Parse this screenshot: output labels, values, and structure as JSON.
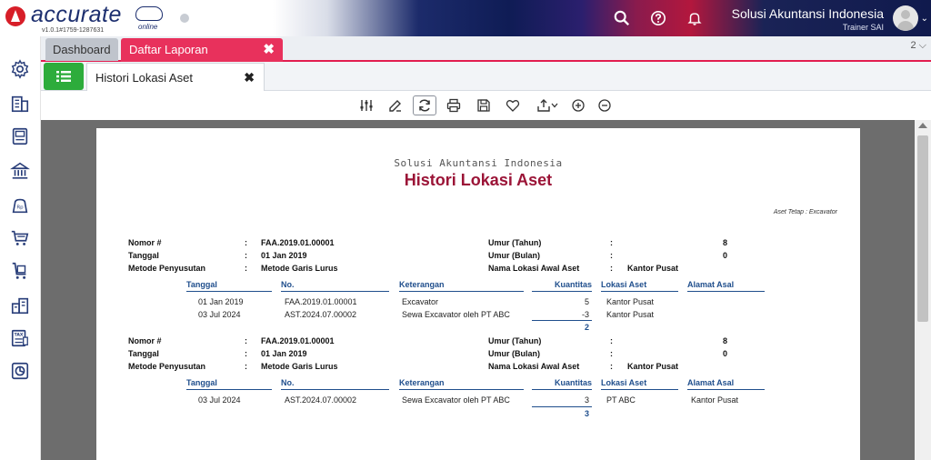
{
  "app": {
    "brand": "accurate",
    "brand_sub": "online",
    "version": "v1.0.1#1759-1287631",
    "company_name": "Solusi Akuntansi Indonesia",
    "user_name": "Trainer SAI"
  },
  "tabs": {
    "dashboard": "Dashboard",
    "daftar_laporan": "Daftar Laporan",
    "close": "✖",
    "count": "2 ⌵",
    "histori": "Histori Lokasi Aset"
  },
  "report": {
    "company": "Solusi Akuntansi Indonesia",
    "title": "Histori Lokasi Aset",
    "filter": "Aset Tetap : Excavator",
    "labels": {
      "nomor": "Nomor #",
      "tanggal": "Tanggal",
      "metode": "Metode Penyusutan",
      "umur_tahun": "Umur (Tahun)",
      "umur_bulan": "Umur (Bulan)",
      "lokasi_awal": "Nama Lokasi Awal Aset",
      "colon": ":"
    },
    "columns": {
      "tanggal": "Tanggal",
      "no": "No.",
      "keterangan": "Keterangan",
      "kuantitas": "Kuantitas",
      "lokasi": "Lokasi Aset",
      "alamat": "Alamat Asal"
    },
    "groups": [
      {
        "nomor": "FAA.2019.01.00001",
        "tanggal": "01 Jan 2019",
        "metode": "Metode Garis Lurus",
        "umur_tahun": "8",
        "umur_bulan": "0",
        "lokasi_awal": "Kantor Pusat",
        "rows": [
          {
            "tanggal": "01 Jan 2019",
            "no": "FAA.2019.01.00001",
            "keterangan": "Excavator",
            "kuantitas": "5",
            "lokasi": "Kantor Pusat",
            "alamat": ""
          },
          {
            "tanggal": "03 Jul 2024",
            "no": "AST.2024.07.00002",
            "keterangan": "Sewa Excavator oleh PT ABC",
            "kuantitas": "-3",
            "lokasi": "Kantor Pusat",
            "alamat": ""
          }
        ],
        "total": "2"
      },
      {
        "nomor": "FAA.2019.01.00001",
        "tanggal": "01 Jan 2019",
        "metode": "Metode Garis Lurus",
        "umur_tahun": "8",
        "umur_bulan": "0",
        "lokasi_awal": "Kantor Pusat",
        "rows": [
          {
            "tanggal": "03 Jul 2024",
            "no": "AST.2024.07.00002",
            "keterangan": "Sewa Excavator oleh PT ABC",
            "kuantitas": "3",
            "lokasi": "PT ABC",
            "alamat": "Kantor Pusat"
          }
        ],
        "total": "3"
      }
    ]
  },
  "icons": {
    "top": [
      "search-icon",
      "help-icon",
      "bell-icon"
    ],
    "sidebar": [
      "settings-icon",
      "company-icon",
      "ledger-icon",
      "bank-icon",
      "sales-icon",
      "cart-icon",
      "purchase-icon",
      "inventory-icon",
      "tax-icon",
      "report-icon"
    ],
    "toolbar": [
      "filter-settings-icon",
      "edit-icon",
      "refresh-icon",
      "print-icon",
      "save-icon",
      "favorite-icon",
      "export-icon",
      "zoom-in-icon",
      "zoom-out-icon"
    ]
  },
  "colors": {
    "brand_red": "#d71e28",
    "tab_active": "#e8315c",
    "report_title": "#9b1437",
    "table_header": "#1f4e8c",
    "list_button": "#2dac3b"
  }
}
